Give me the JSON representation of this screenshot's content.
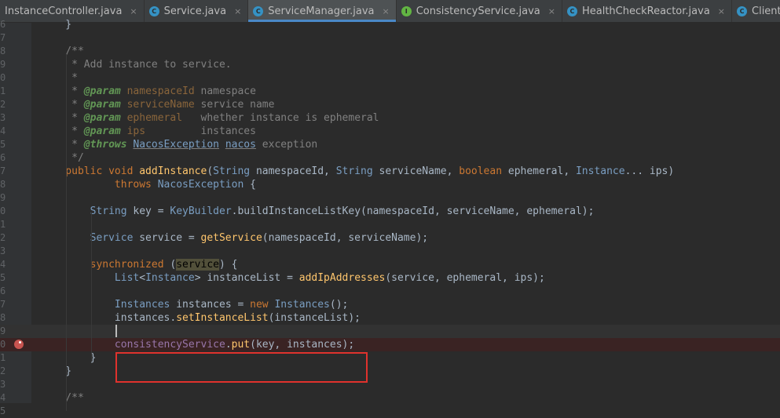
{
  "tabs": [
    {
      "label": "InstanceController.java",
      "icon": "class",
      "active": false
    },
    {
      "label": "Service.java",
      "icon": "class",
      "active": false
    },
    {
      "label": "ServiceManager.java",
      "icon": "class",
      "active": true
    },
    {
      "label": "ConsistencyService.java",
      "icon": "interface",
      "active": false
    },
    {
      "label": "HealthCheckReactor.java",
      "icon": "class",
      "active": false
    },
    {
      "label": "ClientBeatCheckTask.java",
      "icon": "class",
      "active": false
    }
  ],
  "icon_letters": {
    "class": "C",
    "interface": "I"
  },
  "close_glyph": "×",
  "colors": {
    "background": "#2b2b2b",
    "keyword": "#cc7832",
    "comment": "#808080",
    "method": "#ffc66d",
    "member": "#9876aa",
    "type": "#7a9ec2",
    "breakpoint": "#c75450",
    "highlight_box": "#e0322d"
  },
  "editor": {
    "line_numbers": [
      "6",
      "7",
      "8",
      "9",
      "0",
      "1",
      "2",
      "3",
      "4",
      "5",
      "6",
      "7",
      "8",
      "9",
      "0",
      "1",
      "2",
      "3",
      "4",
      "5",
      "6",
      "7",
      "8",
      "9",
      "0",
      "1",
      "2",
      "3",
      "4",
      "5"
    ],
    "lines": [
      [
        [
          "id",
          "    }"
        ]
      ],
      [],
      [
        [
          "cm",
          "    /**"
        ]
      ],
      [
        [
          "cm",
          "     * Add instance to service."
        ]
      ],
      [
        [
          "cm",
          "     *"
        ]
      ],
      [
        [
          "cm",
          "     * "
        ],
        [
          "tag",
          "@param"
        ],
        [
          "pn",
          " namespaceId"
        ],
        [
          "cm",
          " namespace"
        ]
      ],
      [
        [
          "cm",
          "     * "
        ],
        [
          "tag",
          "@param"
        ],
        [
          "pn",
          " serviceName"
        ],
        [
          "cm",
          " service name"
        ]
      ],
      [
        [
          "cm",
          "     * "
        ],
        [
          "tag",
          "@param"
        ],
        [
          "pn",
          " ephemeral"
        ],
        [
          "cm",
          "   whether instance is ephemeral"
        ]
      ],
      [
        [
          "cm",
          "     * "
        ],
        [
          "tag",
          "@param"
        ],
        [
          "pn",
          " ips"
        ],
        [
          "cm",
          "         instances"
        ]
      ],
      [
        [
          "cm",
          "     * "
        ],
        [
          "tag",
          "@throws"
        ],
        [
          "cm",
          " "
        ],
        [
          "ul",
          "NacosException"
        ],
        [
          "cm",
          " "
        ],
        [
          "ul",
          "nacos"
        ],
        [
          "cm",
          " exception"
        ]
      ],
      [
        [
          "cm",
          "     */"
        ]
      ],
      [
        [
          "kw",
          "    public void "
        ],
        [
          "fn",
          "addInstance"
        ],
        [
          "id",
          "("
        ],
        [
          "ty",
          "String"
        ],
        [
          "id",
          " namespaceId, "
        ],
        [
          "ty",
          "String"
        ],
        [
          "id",
          " serviceName, "
        ],
        [
          "kw",
          "boolean"
        ],
        [
          "id",
          " ephemeral, "
        ],
        [
          "ty",
          "Instance"
        ],
        [
          "id",
          "... ips)"
        ]
      ],
      [
        [
          "kw",
          "            throws "
        ],
        [
          "ty",
          "NacosException"
        ],
        [
          "id",
          " {"
        ]
      ],
      [],
      [
        [
          "ty",
          "        String"
        ],
        [
          "id",
          " key = "
        ],
        [
          "ty",
          "KeyBuilder"
        ],
        [
          "id",
          "."
        ],
        [
          "id",
          "buildInstanceListKey(namespaceId, serviceName, ephemeral);"
        ]
      ],
      [],
      [
        [
          "ty",
          "        Service"
        ],
        [
          "id",
          " service = "
        ],
        [
          "fn",
          "getService"
        ],
        [
          "id",
          "(namespaceId, serviceName);"
        ]
      ],
      [],
      [
        [
          "kw",
          "        synchronized "
        ],
        [
          "id",
          "("
        ],
        [
          "sel",
          "service"
        ],
        [
          "id",
          ") {"
        ]
      ],
      [
        [
          "ty",
          "            List"
        ],
        [
          "id",
          "<"
        ],
        [
          "ty",
          "Instance"
        ],
        [
          "id",
          "> instanceList = "
        ],
        [
          "fn",
          "addIpAddresses"
        ],
        [
          "id",
          "(service, ephemeral, ips);"
        ]
      ],
      [],
      [
        [
          "ty",
          "            Instances"
        ],
        [
          "id",
          " instances = "
        ],
        [
          "kw",
          "new "
        ],
        [
          "ty",
          "Instances"
        ],
        [
          "id",
          "();"
        ]
      ],
      [
        [
          "id",
          "            instances."
        ],
        [
          "fn",
          "setInstanceList"
        ],
        [
          "id",
          "(instanceList);"
        ]
      ],
      [],
      [
        [
          "m",
          "            consistencyService"
        ],
        [
          "id",
          "."
        ],
        [
          "fn",
          "put"
        ],
        [
          "id",
          "(key, instances);"
        ]
      ],
      [
        [
          "id",
          "        }"
        ]
      ],
      [
        [
          "id",
          "    }"
        ]
      ],
      [],
      [
        [
          "cm",
          "    /**"
        ]
      ],
      []
    ]
  }
}
